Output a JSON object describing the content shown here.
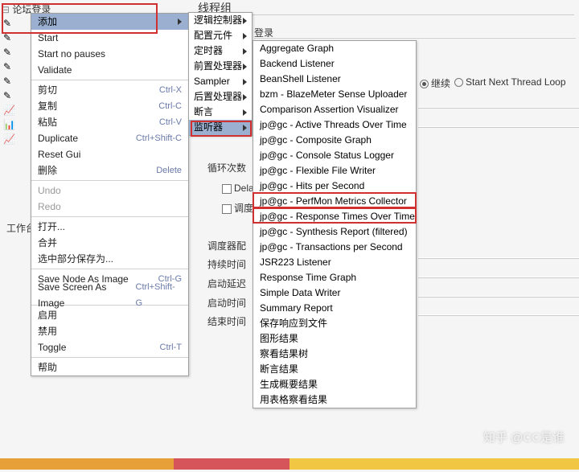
{
  "tree": {
    "root": "论坛登录",
    "workspace": "工作台"
  },
  "bg": {
    "threadGroup": "线程组",
    "login": "登录",
    "continueLabel": "继续",
    "startNextLoop": "Start Next Thread Loop",
    "loopCount": "循环次数",
    "delay": "Delay",
    "scheduler": "调度器",
    "schedulerConfig": "调度器配",
    "duration": "持续时间",
    "startDelay": "启动延迟",
    "startTime": "启动时间",
    "endTime": "结束时间"
  },
  "menu1": [
    {
      "label": "添加",
      "sel": true,
      "arrow": true
    },
    {
      "label": "Start"
    },
    {
      "label": "Start no pauses"
    },
    {
      "label": "Validate"
    },
    {
      "sep": true
    },
    {
      "label": "剪切",
      "shortcut": "Ctrl-X"
    },
    {
      "label": "复制",
      "shortcut": "Ctrl-C"
    },
    {
      "label": "粘贴",
      "shortcut": "Ctrl-V"
    },
    {
      "label": "Duplicate",
      "shortcut": "Ctrl+Shift-C"
    },
    {
      "label": "Reset Gui"
    },
    {
      "label": "删除",
      "shortcut": "Delete"
    },
    {
      "sep": true
    },
    {
      "label": "Undo",
      "disabled": true
    },
    {
      "label": "Redo",
      "disabled": true
    },
    {
      "sep": true
    },
    {
      "label": "打开..."
    },
    {
      "label": "合并"
    },
    {
      "label": "选中部分保存为..."
    },
    {
      "sep": true
    },
    {
      "label": "Save Node As Image",
      "shortcut": "Ctrl-G"
    },
    {
      "label": "Save Screen As Image",
      "shortcut": "Ctrl+Shift-G"
    },
    {
      "sep": true
    },
    {
      "label": "启用"
    },
    {
      "label": "禁用"
    },
    {
      "label": "Toggle",
      "shortcut": "Ctrl-T"
    },
    {
      "sep": true
    },
    {
      "label": "帮助"
    }
  ],
  "menu2": [
    {
      "label": "逻辑控制器",
      "arrow": true
    },
    {
      "label": "配置元件",
      "arrow": true
    },
    {
      "label": "定时器",
      "arrow": true
    },
    {
      "label": "前置处理器",
      "arrow": true
    },
    {
      "label": "Sampler",
      "arrow": true
    },
    {
      "label": "后置处理器",
      "arrow": true
    },
    {
      "label": "断言",
      "arrow": true
    },
    {
      "label": "监听器",
      "sel": true,
      "arrow": true
    }
  ],
  "menu3": [
    "Aggregate Graph",
    "Backend Listener",
    "BeanShell Listener",
    "bzm - BlazeMeter Sense Uploader",
    "Comparison Assertion Visualizer",
    "jp@gc - Active Threads Over Time",
    "jp@gc - Composite Graph",
    "jp@gc - Console Status Logger",
    "jp@gc - Flexible File Writer",
    "jp@gc - Hits per Second",
    "jp@gc - PerfMon Metrics Collector",
    "jp@gc - Response Times Over Time",
    "jp@gc - Synthesis Report (filtered)",
    "jp@gc - Transactions per Second",
    "JSR223 Listener",
    "Response Time Graph",
    "Simple Data Writer",
    "Summary Report",
    "保存响应到文件",
    "图形结果",
    "察看结果树",
    "断言结果",
    "生成概要结果",
    "用表格察看结果"
  ],
  "watermark": "知乎 @CC是谁"
}
